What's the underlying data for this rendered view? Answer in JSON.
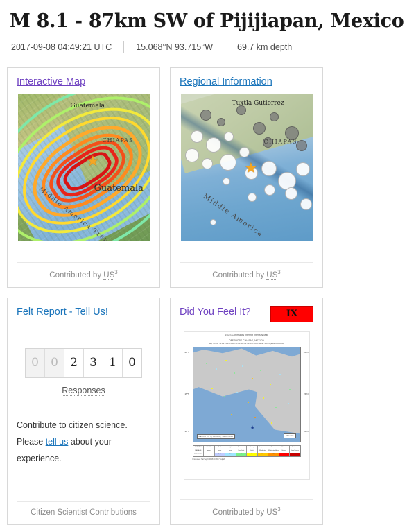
{
  "header": {
    "title": "M 8.1 - 87km SW of Pijijiapan, Mexico",
    "time": "2017-09-08 04:49:21 UTC",
    "coordinates": "15.068°N  93.715°W",
    "depth": "69.7 km depth"
  },
  "cards": {
    "interactive_map": {
      "title": "Interactive Map",
      "link_state": "visited",
      "footer_prefix": "Contributed by ",
      "footer_abbr": "US",
      "footer_sup": "3",
      "map_labels": {
        "city": "Guatemala",
        "region": "CHIAPAS",
        "state": "Guatemala",
        "trench": "Middle America Trench"
      }
    },
    "regional_information": {
      "title": "Regional Information",
      "link_state": "unvisited",
      "footer_prefix": "Contributed by ",
      "footer_abbr": "US",
      "footer_sup": "3",
      "map_labels": {
        "city": "Tuxtla Gutierrez",
        "region": "CHIAPAS",
        "trench": "Middle America"
      }
    },
    "felt_report": {
      "title": "Felt Report - Tell Us!",
      "link_state": "unvisited",
      "odometer_digits": [
        "0",
        "0",
        "2",
        "3",
        "1",
        "0"
      ],
      "odometer_leading_count": 2,
      "responses_label": "Responses",
      "body_line1": "Contribute to citizen science.",
      "body_line2_pre": "Please ",
      "body_line2_link": "tell us",
      "body_line2_post": " about your",
      "body_line3": "experience.",
      "footer": "Citizen Scientist Contributions"
    },
    "did_you_feel_it": {
      "title": "Did You Feel It?",
      "link_state": "visited",
      "intensity_badge": "IX",
      "badge_color": "#ff0000",
      "footer_prefix": "Contributed by ",
      "footer_abbr": "US",
      "footer_sup": "3",
      "dyfi_map": {
        "title_line1": "USGS Community Internet Intensity Map",
        "title_line2": "OFFSHORE CHIAPAS, MEXICO",
        "title_line3": "Sep 7 2017 11:49:21 PM local 15.0678N 93.7150W M8.1 Depth: 69 km (Eval:000/band)",
        "lat_labels": [
          "20°N",
          "15°N",
          "10°N"
        ],
        "lon_labels": [
          "95°W",
          "90°W"
        ],
        "scalebar": "100 miles",
        "citybar": "MEXICO CITY  |  OAXACA  |  TAPACHULA",
        "legend_headers": [
          "SHAKING",
          "Not felt",
          "Weak",
          "Light",
          "Moderate",
          "Strong",
          "Very strong",
          "Severe",
          "Violent",
          "Extreme"
        ],
        "legend_damage": [
          "DAMAGE",
          "none",
          "none",
          "none",
          "Very light",
          "Light",
          "Moderate",
          "Moderate/Heavy",
          "Heavy",
          "Very Heavy"
        ],
        "legend_intensity": [
          "INTENSITY",
          "I",
          "II-III",
          "IV",
          "V",
          "VI",
          "VII",
          "VIII",
          "IX",
          "X+"
        ],
        "legend_colors": [
          "#ffffff",
          "#ffffff",
          "#bfccff",
          "#a0e6ff",
          "#7cf08a",
          "#ffff00",
          "#ffc800",
          "#ff9100",
          "#ff0000",
          "#c80000"
        ],
        "processed": "Processed: Sat Sep 9 06:28:00 2017 mdgs8"
      }
    }
  },
  "colors": {
    "link_unvisited": "#1b75bb",
    "link_visited": "#6f42c1",
    "intensity_ix": "#ff0000",
    "card_border": "#d8d8d8"
  }
}
